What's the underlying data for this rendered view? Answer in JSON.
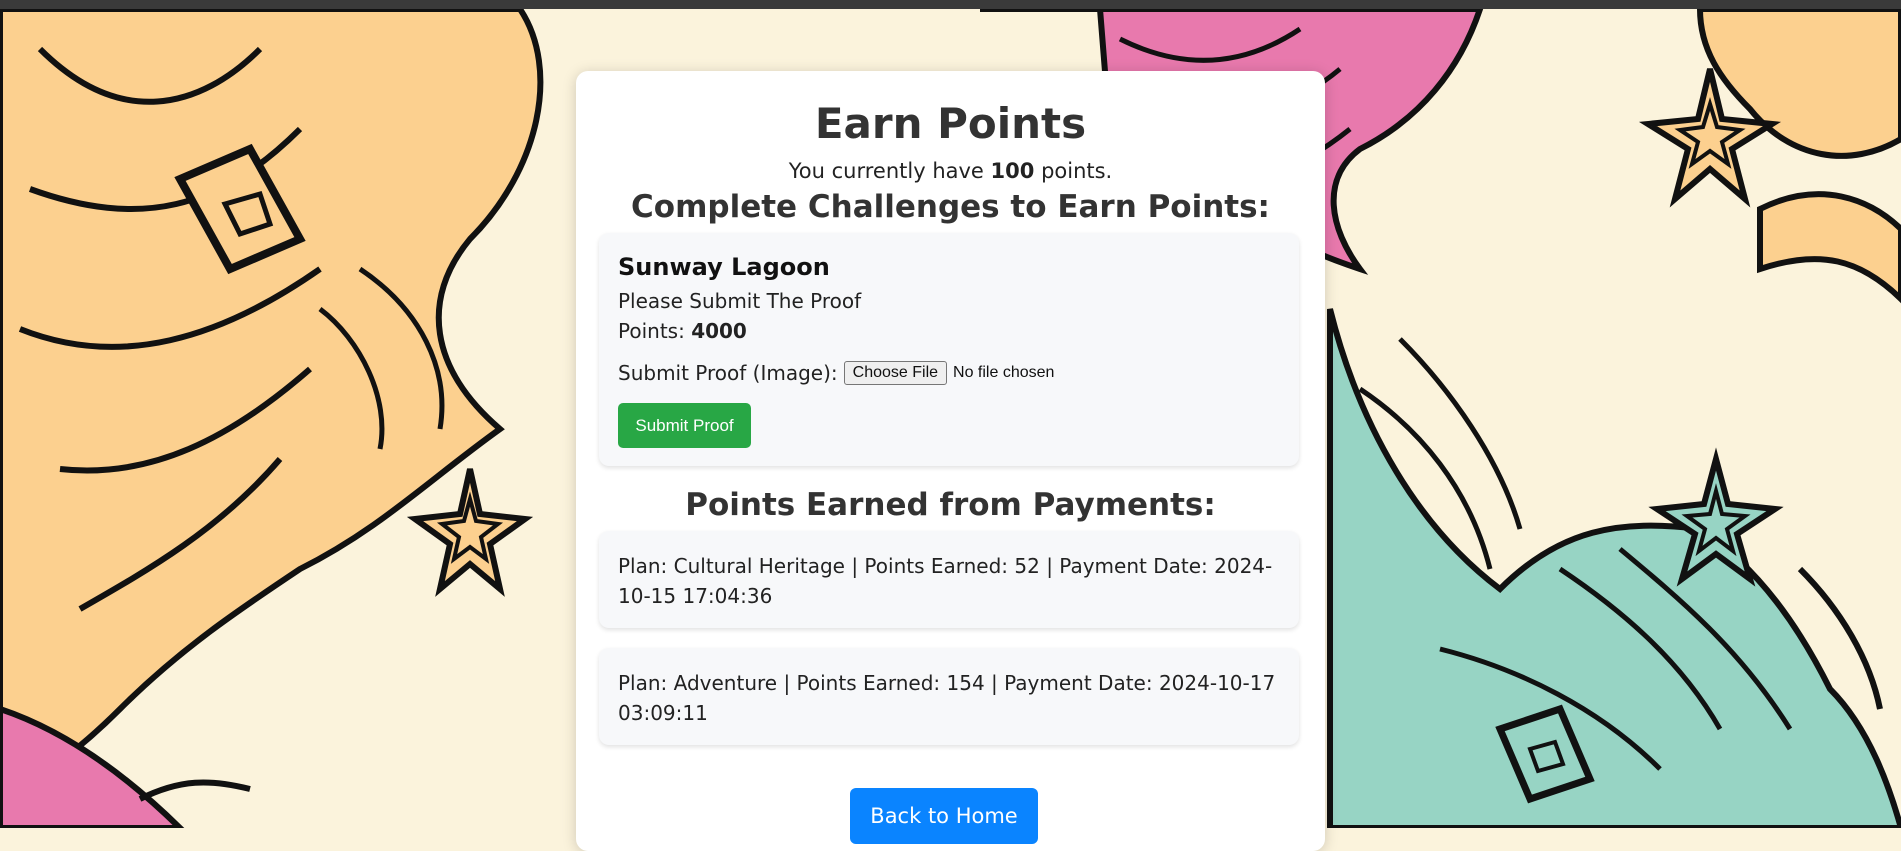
{
  "page": {
    "title": "Earn Points",
    "points_prefix": "You currently have",
    "points_value": "100",
    "points_suffix": "points."
  },
  "challenges": {
    "heading": "Complete Challenges to Earn Points:",
    "items": [
      {
        "name": "Sunway Lagoon",
        "description": "Please Submit The Proof",
        "points_label": "Points:",
        "points_value": "4000",
        "proof_label": "Submit Proof (Image):",
        "file_button_label": "Choose File",
        "file_status": "No file chosen",
        "submit_label": "Submit Proof"
      }
    ]
  },
  "payments": {
    "heading": "Points Earned from Payments:",
    "items": [
      {
        "text": "Plan: Cultural Heritage | Points Earned: 52 | Payment Date: 2024-10-15 17:04:36"
      },
      {
        "text": "Plan: Adventure | Points Earned: 154 | Payment Date: 2024-10-17 03:09:11"
      }
    ]
  },
  "nav": {
    "back_label": "Back to Home"
  },
  "colors": {
    "background": "#fbf3dc",
    "orange_pattern": "#fcd08f",
    "pink_pattern": "#e879ad",
    "teal_pattern": "#97d4c4",
    "submit_green": "#28a745",
    "home_blue": "#0a84ff"
  }
}
